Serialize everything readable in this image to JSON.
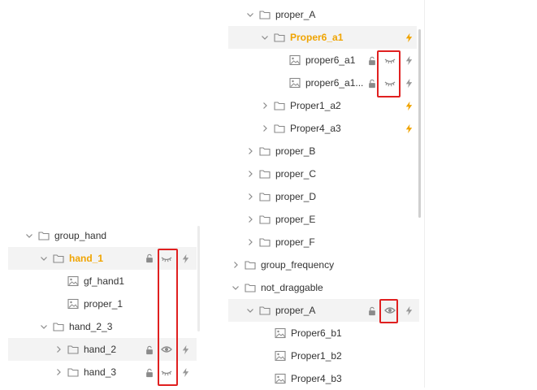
{
  "colors": {
    "highlight": "#f0a400",
    "redbox": "#e02020",
    "selected_bg": "#f3f3f3"
  },
  "left_tree": {
    "rows": [
      {
        "label": "group_hand"
      },
      {
        "label": "hand_1"
      },
      {
        "label": "gf_hand1"
      },
      {
        "label": "proper_1"
      },
      {
        "label": "hand_2_3"
      },
      {
        "label": "hand_2"
      },
      {
        "label": "hand_3"
      }
    ]
  },
  "right_tree": {
    "rows": [
      {
        "label": "proper_A"
      },
      {
        "label": "Proper6_a1"
      },
      {
        "label": "proper6_a1"
      },
      {
        "label": "proper6_a1..."
      },
      {
        "label": "Proper1_a2"
      },
      {
        "label": "Proper4_a3"
      },
      {
        "label": "proper_B"
      },
      {
        "label": "proper_C"
      },
      {
        "label": "proper_D"
      },
      {
        "label": "proper_E"
      },
      {
        "label": "proper_F"
      },
      {
        "label": "group_frequency"
      },
      {
        "label": "not_draggable"
      },
      {
        "label": "proper_A"
      },
      {
        "label": "Proper6_b1"
      },
      {
        "label": "Proper1_b2"
      },
      {
        "label": "Proper4_b3"
      }
    ]
  }
}
